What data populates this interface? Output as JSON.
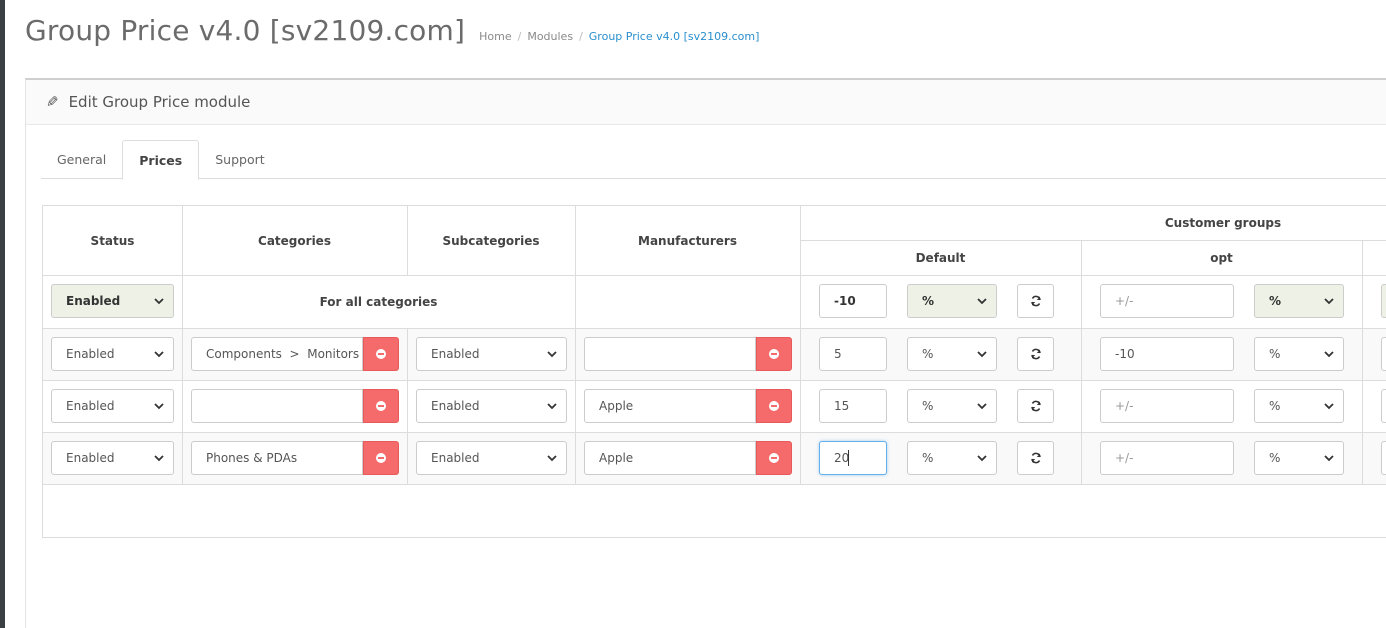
{
  "page": {
    "title": "Group Price v4.0 [sv2109.com]",
    "breadcrumb": [
      "Home",
      "Modules",
      "Group Price v4.0 [sv2109.com]"
    ]
  },
  "panel": {
    "title": "Edit Group Price module",
    "icon": "pencil-icon"
  },
  "tabs": [
    {
      "label": "General",
      "active": false
    },
    {
      "label": "Prices",
      "active": true
    },
    {
      "label": "Support",
      "active": false
    }
  ],
  "table": {
    "headers": {
      "status": "Status",
      "categories": "Categories",
      "subcategories": "Subcategories",
      "manufacturers": "Manufacturers",
      "customer_groups": "Customer groups",
      "groups": [
        "Default",
        "opt"
      ]
    },
    "default_row": {
      "status": "Enabled",
      "categories_text": "For all categories",
      "default_value": "-10",
      "default_unit": "%",
      "opt_placeholder": "+/-",
      "opt_unit": "%"
    },
    "rows": [
      {
        "status": "Enabled",
        "category": "Components  >  Monitors",
        "subcategories": "Enabled",
        "manufacturer": "",
        "default_value": "5",
        "default_unit": "%",
        "opt_value": "-10",
        "opt_placeholder": "+/-",
        "opt_unit": "%"
      },
      {
        "status": "Enabled",
        "category": "",
        "subcategories": "Enabled",
        "manufacturer": "Apple",
        "default_value": "15",
        "default_unit": "%",
        "opt_value": "",
        "opt_placeholder": "+/-",
        "opt_unit": "%"
      },
      {
        "status": "Enabled",
        "category": "Phones & PDAs",
        "subcategories": "Enabled",
        "manufacturer": "Apple",
        "default_value": "20",
        "default_unit": "%",
        "opt_value": "",
        "opt_placeholder": "+/-",
        "opt_unit": "%"
      }
    ]
  },
  "colors": {
    "accent_link": "#2a8fcc",
    "danger": "#f56b6b",
    "default_row_select": "#eef2e6"
  }
}
